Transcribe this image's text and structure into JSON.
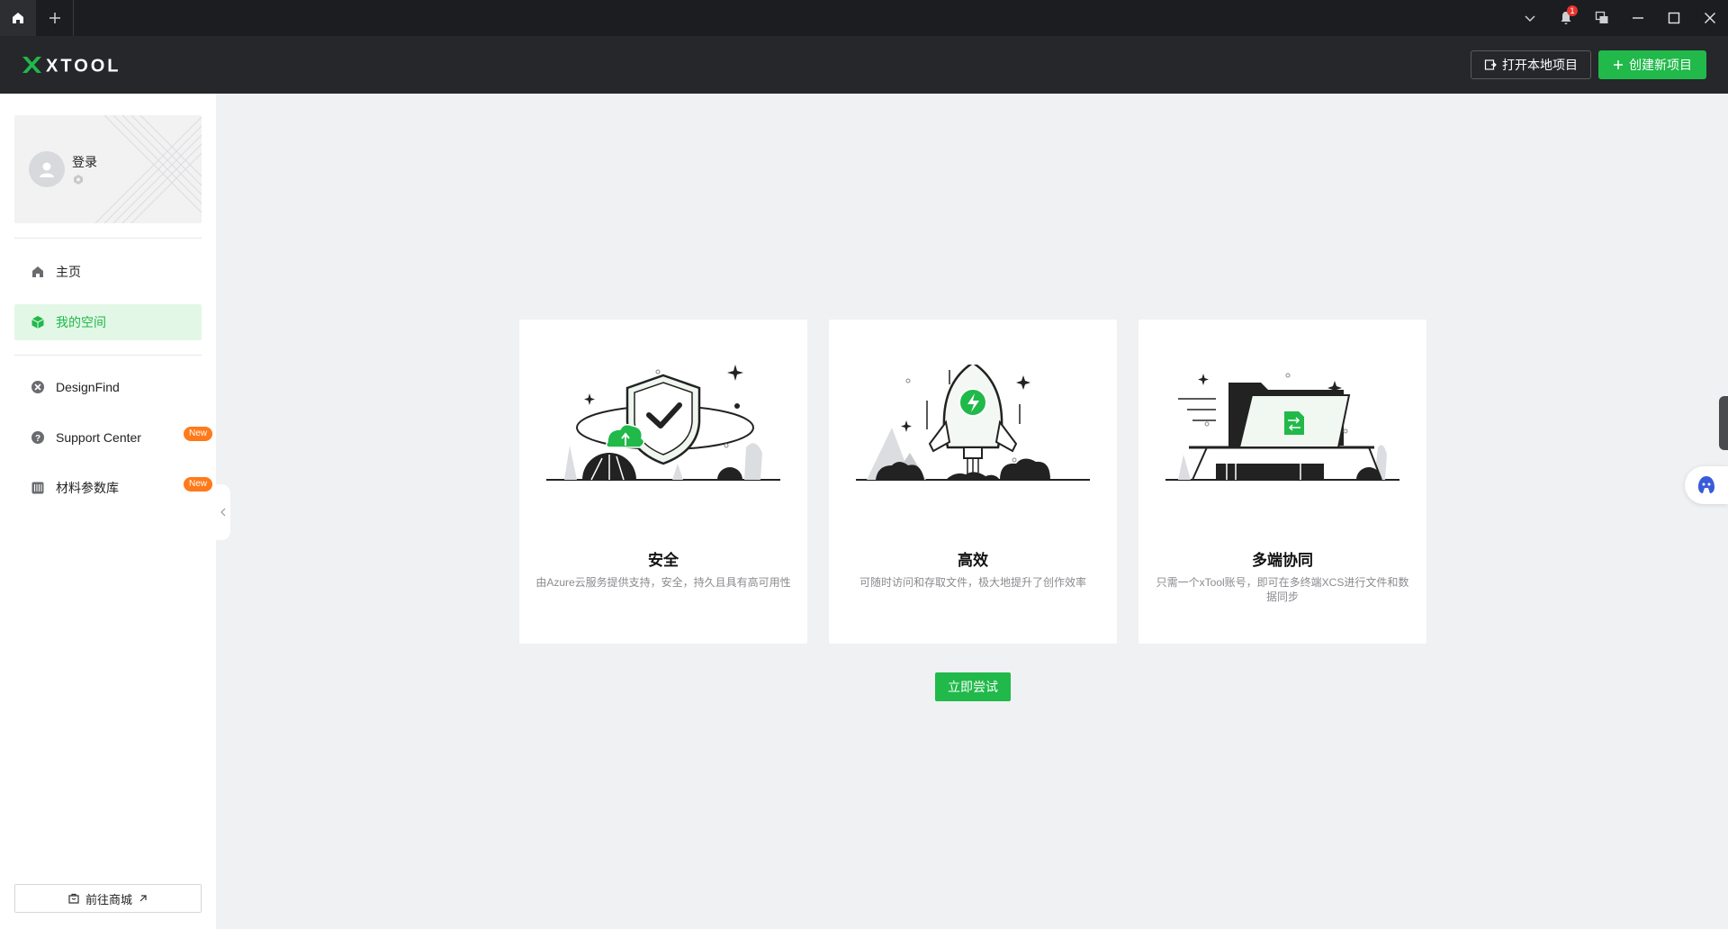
{
  "titlebar": {
    "notification_count": "1"
  },
  "header": {
    "logo": "XTOOL",
    "open_local_label": "打开本地项目",
    "create_new_label": "创建新项目"
  },
  "profile": {
    "login_label": "登录"
  },
  "nav": {
    "items": [
      {
        "label": "主页",
        "icon": "home-icon"
      },
      {
        "label": "我的空间",
        "icon": "cube-icon",
        "active": true
      },
      {
        "label": "DesignFind",
        "icon": "designfind-icon"
      },
      {
        "label": "Support Center",
        "icon": "help-icon",
        "badge": "New"
      },
      {
        "label": "材料参数库",
        "icon": "material-library-icon",
        "badge": "New"
      }
    ]
  },
  "store_button_label": "前往商城",
  "features": [
    {
      "title": "安全",
      "description": "由Azure云服务提供支持，安全，持久且具有高可用性"
    },
    {
      "title": "高效",
      "description": "可随时访问和存取文件，极大地提升了创作效率"
    },
    {
      "title": "多端协同",
      "description": "只需一个xTool账号，即可在多终端XCS进行文件和数据同步"
    }
  ],
  "try_now_label": "立即尝试",
  "colors": {
    "accent": "#20b94a",
    "badge": "#ff7a1a",
    "titlebar": "#1c1d20",
    "header": "#26272b",
    "background": "#f0f1f3"
  }
}
